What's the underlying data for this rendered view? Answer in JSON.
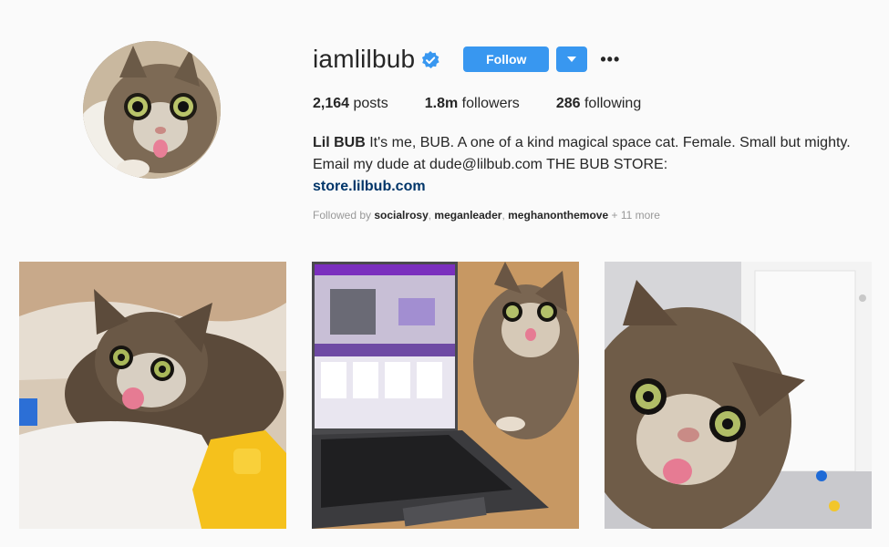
{
  "profile": {
    "username": "iamlilbub",
    "follow_label": "Follow",
    "more_label": "•••"
  },
  "stats": {
    "posts_count": "2,164",
    "posts_label": "posts",
    "followers_count": "1.8m",
    "followers_label": "followers",
    "following_count": "286",
    "following_label": "following"
  },
  "bio": {
    "name": "Lil BUB",
    "text": "It's me, BUB. A one of a kind magical space cat. Female. Small but mighty. Email my dude at dude@lilbub.com THE BUB STORE:",
    "link": "store.lilbub.com"
  },
  "followed_by": {
    "prefix": "Followed by",
    "users": [
      "socialrosy",
      "meganleader",
      "meghanonthemove"
    ],
    "more": "+ 11 more"
  },
  "colors": {
    "accent": "#3897f0",
    "link": "#003569",
    "background": "#fafafa"
  },
  "icons": {
    "verified": "verified-badge-icon",
    "dropdown": "caret-down-icon",
    "more": "ellipsis-icon"
  }
}
